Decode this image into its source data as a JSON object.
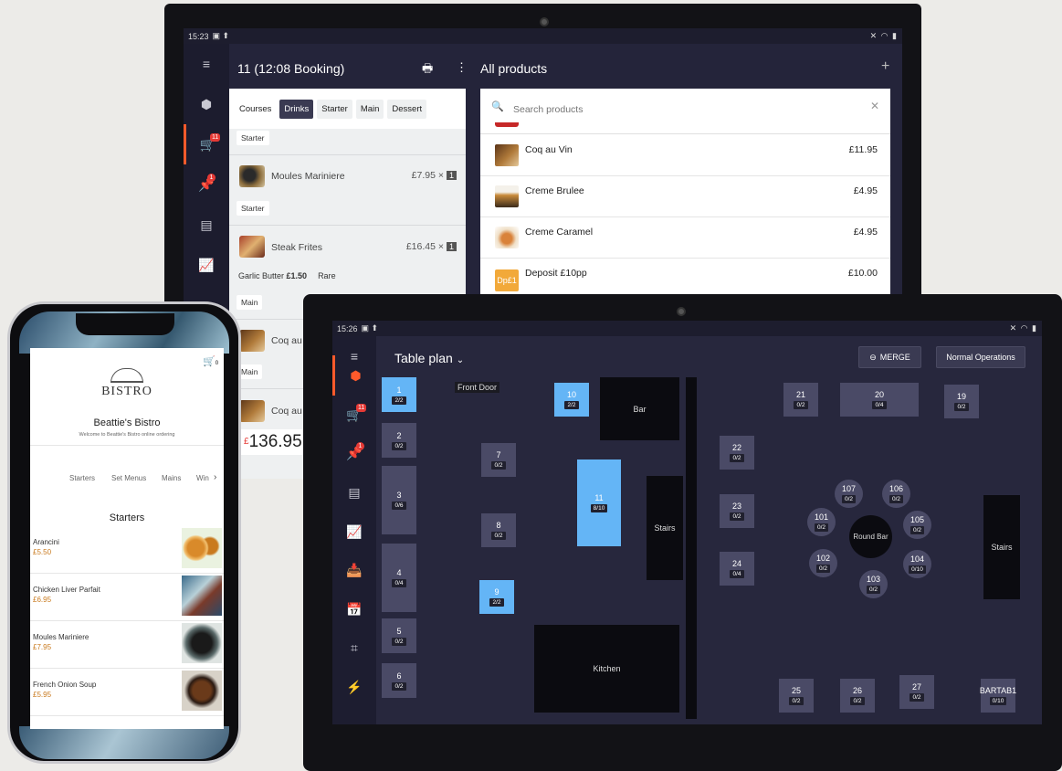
{
  "pos_order": {
    "status_time": "15:23",
    "order_title": "11 (12:08 Booking)",
    "products_title": "All products",
    "rail_badges": {
      "cart": "11",
      "pin": "1"
    },
    "course_tabs": [
      "Courses",
      "Drinks",
      "Starter",
      "Main",
      "Dessert"
    ],
    "active_tab": "Drinks",
    "lines": [
      {
        "course": "Starter"
      },
      {
        "name": "Moules Mariniere",
        "price": "£7.95 ×",
        "qty": "1",
        "course": "Starter"
      },
      {
        "name": "Steak Frites",
        "price": "£16.45 ×",
        "qty": "1",
        "modifier": "Garlic Butter",
        "modifier_price": "£1.50",
        "modifier2": "Rare",
        "course": "Main"
      },
      {
        "name": "Coq au",
        "course": "Main"
      },
      {
        "name": "Coq au"
      }
    ],
    "total": "136.95",
    "total_prefix": "£",
    "search_placeholder": "Search products",
    "products": [
      {
        "name": "Coq au Vin",
        "price": "£11.95"
      },
      {
        "name": "Creme Brulee",
        "price": "£4.95"
      },
      {
        "name": "Creme Caramel",
        "price": "£4.95"
      },
      {
        "name": "Deposit £10pp",
        "price": "£10.00",
        "thumb_text": "Dp£1"
      }
    ]
  },
  "table_plan": {
    "status_time": "15:26",
    "title": "Table plan",
    "merge_label": "MERGE",
    "mode_label": "Normal Operations",
    "rail_badges": {
      "cart": "11",
      "pin": "1"
    },
    "front_door": "Front Door",
    "blocks": {
      "bar": "Bar",
      "stairs1": "Stairs",
      "kitchen": "Kitchen",
      "round_bar": "Round Bar",
      "stairs2": "Stairs"
    },
    "tables": [
      {
        "id": "1",
        "cov": "2/2"
      },
      {
        "id": "2",
        "cov": "0/2"
      },
      {
        "id": "3",
        "cov": "0/6"
      },
      {
        "id": "4",
        "cov": "0/4"
      },
      {
        "id": "5",
        "cov": "0/2"
      },
      {
        "id": "6",
        "cov": "0/2"
      },
      {
        "id": "7",
        "cov": "0/2"
      },
      {
        "id": "8",
        "cov": "0/2"
      },
      {
        "id": "9",
        "cov": "2/2"
      },
      {
        "id": "10",
        "cov": "2/2"
      },
      {
        "id": "11",
        "cov": "8/10"
      },
      {
        "id": "22",
        "cov": "0/2"
      },
      {
        "id": "23",
        "cov": "0/2"
      },
      {
        "id": "24",
        "cov": "0/4"
      },
      {
        "id": "21",
        "cov": "0/2"
      },
      {
        "id": "20",
        "cov": "0/4"
      },
      {
        "id": "19",
        "cov": "0/2"
      },
      {
        "id": "107",
        "cov": "0/2"
      },
      {
        "id": "106",
        "cov": "0/2"
      },
      {
        "id": "101",
        "cov": "0/2"
      },
      {
        "id": "105",
        "cov": "0/2"
      },
      {
        "id": "102",
        "cov": "0/2"
      },
      {
        "id": "104",
        "cov": "0/10"
      },
      {
        "id": "103",
        "cov": "0/2"
      },
      {
        "id": "25",
        "cov": "0/2"
      },
      {
        "id": "26",
        "cov": "0/2"
      },
      {
        "id": "27",
        "cov": "0/2"
      },
      {
        "id": "BARTAB1",
        "cov": "0/10"
      }
    ]
  },
  "phone_app": {
    "cart_count": "0",
    "brand": "BISTRO",
    "restaurant": "Beattie's Bistro",
    "welcome": "Welcome to Beattie's Bistro online ordering",
    "categories": [
      "Starters",
      "Set Menus",
      "Mains",
      "Win"
    ],
    "section": "Starters",
    "items": [
      {
        "name": "Arancini",
        "price": "£5.50"
      },
      {
        "name": "Chicken Liver Parfait",
        "price": "£6.95"
      },
      {
        "name": "Moules Mariniere",
        "price": "£7.95"
      },
      {
        "name": "French Onion Soup",
        "price": "£5.95"
      }
    ]
  }
}
